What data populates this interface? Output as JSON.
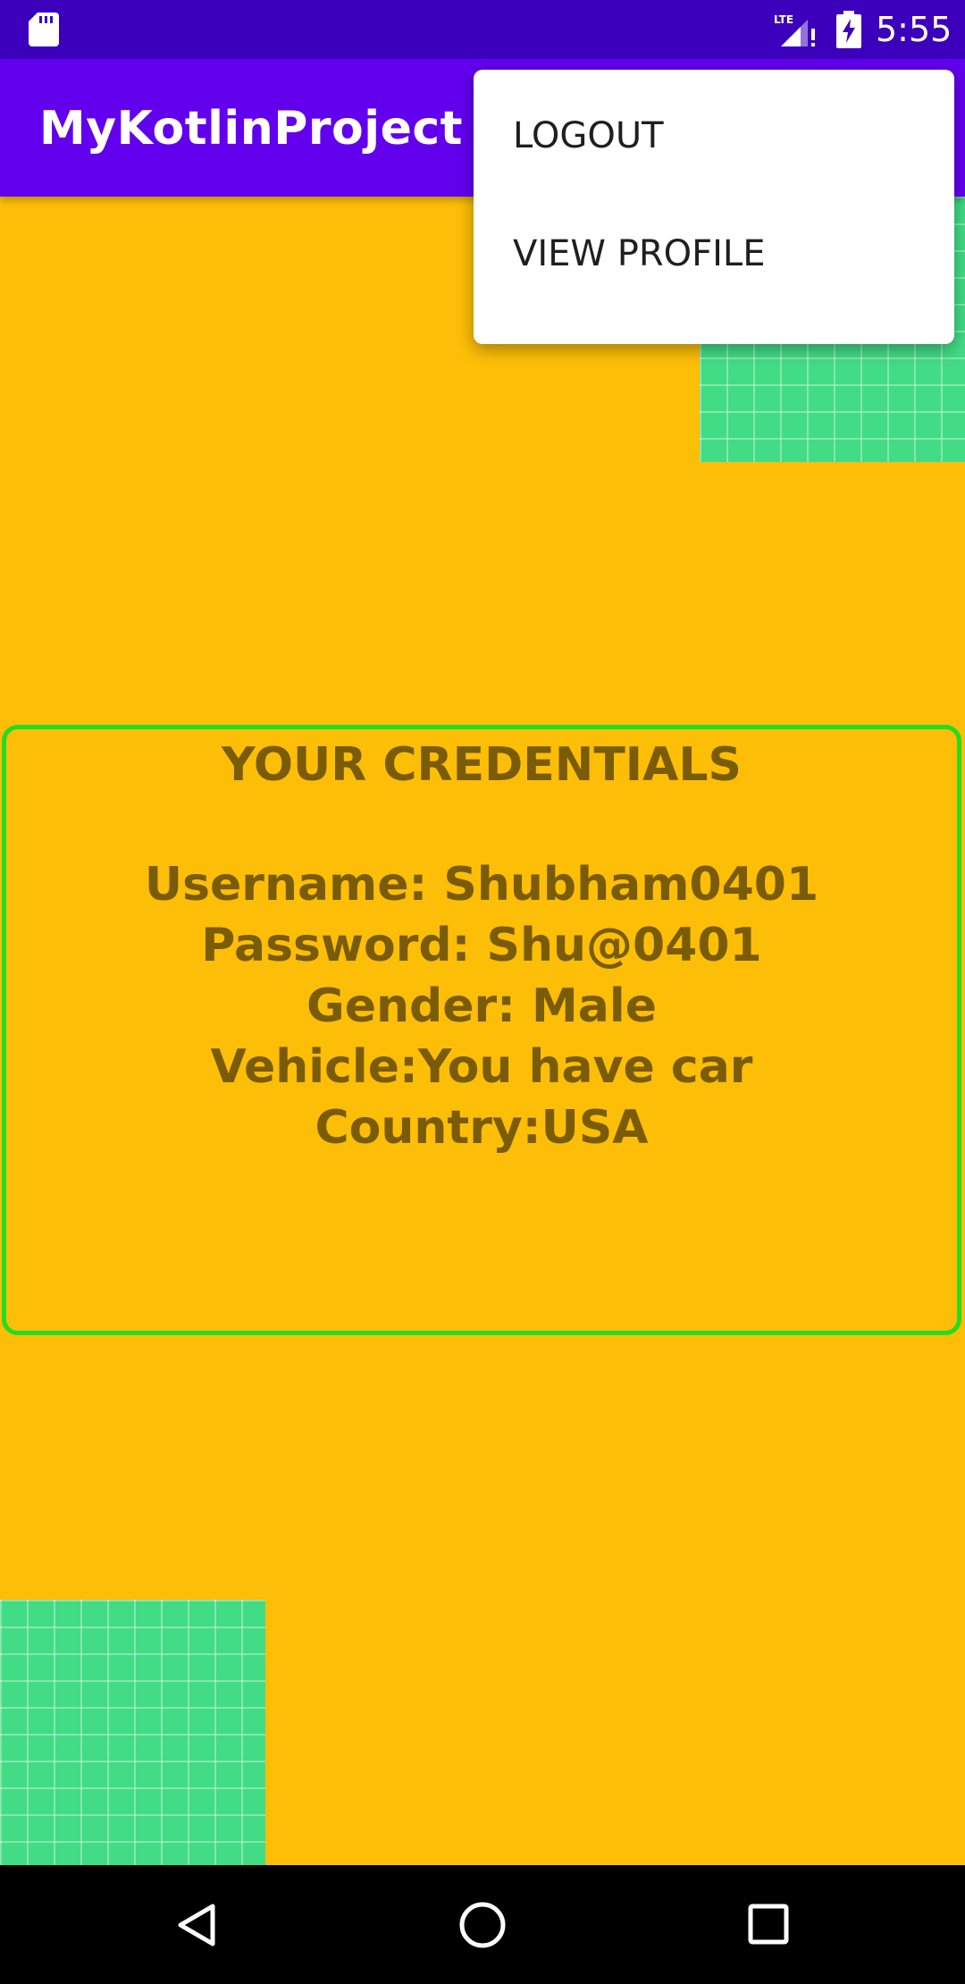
{
  "status_bar": {
    "time": "5:55",
    "network": "LTE",
    "icons": [
      "sd-card-icon",
      "signal-icon",
      "battery-charging-icon"
    ]
  },
  "app_bar": {
    "title": "MyKotlinProject"
  },
  "overflow_menu": {
    "items": [
      {
        "label": "LOGOUT"
      },
      {
        "label": "VIEW PROFILE"
      }
    ]
  },
  "credentials": {
    "heading": "YOUR CREDENTIALS",
    "username": "Username: Shubham0401",
    "password": "Password: Shu@0401",
    "gender": "Gender: Male",
    "vehicle": "Vehicle:You have car",
    "country": "Country:USA"
  },
  "nav_bar": {
    "icons": [
      "back-icon",
      "home-icon",
      "recents-icon"
    ]
  },
  "colors": {
    "status_bar": "#3C00BC",
    "app_bar": "#6200EE",
    "background": "#FDBE08",
    "grid_tile": "#42DC85",
    "card_border": "#22DD22",
    "card_text": "#7A5B06"
  }
}
